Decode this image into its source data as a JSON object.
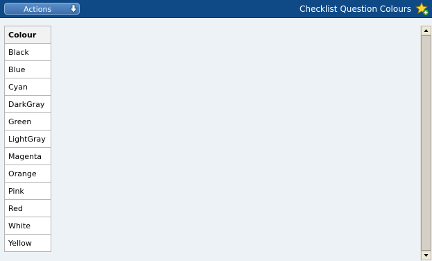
{
  "toolbar": {
    "actions_label": "Actions",
    "title": "Checklist Question Colours"
  },
  "table": {
    "header": "Colour",
    "rows": [
      "Black",
      "Blue",
      "Cyan",
      "DarkGray",
      "Green",
      "LightGray",
      "Magenta",
      "Orange",
      "Pink",
      "Red",
      "White",
      "Yellow"
    ]
  },
  "icons": {
    "actions_arrow": "arrow-down-icon",
    "favorite": "star-add-icon",
    "scroll_up": "scroll-up-arrow-icon",
    "scroll_down": "scroll-down-arrow-icon"
  },
  "colors": {
    "topbar": "#0f4a87",
    "background": "#edf2f7",
    "button": "#4a7fbb"
  }
}
